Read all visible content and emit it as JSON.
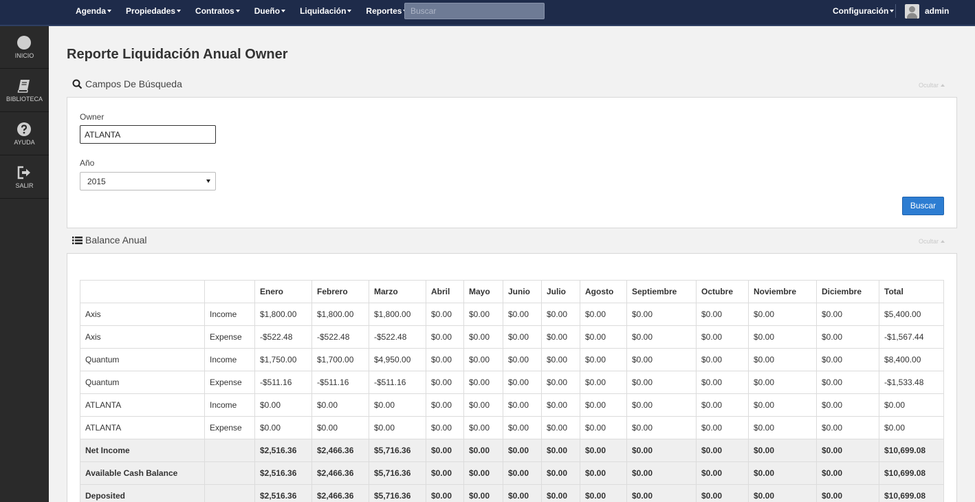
{
  "nav": {
    "items": [
      "Agenda",
      "Propiedades",
      "Contratos",
      "Dueño",
      "Liquidación",
      "Reportes"
    ],
    "search_placeholder": "Buscar",
    "config_label": "Configuración",
    "user_name": "admin"
  },
  "sidebar": {
    "items": [
      {
        "label": "INICIO",
        "icon": "circle-icon"
      },
      {
        "label": "BIBLIOTECA",
        "icon": "book-icon"
      },
      {
        "label": "AYUDA",
        "icon": "help-icon"
      },
      {
        "label": "SALIR",
        "icon": "logout-icon"
      }
    ]
  },
  "page": {
    "title": "Reporte Liquidación Anual Owner"
  },
  "search_section": {
    "title": "Campos De Búsqueda",
    "hide_label": "Ocultar",
    "owner_label": "Owner",
    "owner_value": "ATLANTA",
    "year_label": "Año",
    "year_value": "2015",
    "submit_label": "Buscar"
  },
  "balance_section": {
    "title": "Balance Anual",
    "hide_label": "Ocultar",
    "columns": [
      "",
      "",
      "Enero",
      "Febrero",
      "Marzo",
      "Abril",
      "Mayo",
      "Junio",
      "Julio",
      "Agosto",
      "Septiembre",
      "Octubre",
      "Noviembre",
      "Diciembre",
      "Total"
    ],
    "rows": [
      [
        "Axis",
        "Income",
        "$1,800.00",
        "$1,800.00",
        "$1,800.00",
        "$0.00",
        "$0.00",
        "$0.00",
        "$0.00",
        "$0.00",
        "$0.00",
        "$0.00",
        "$0.00",
        "$0.00",
        "$5,400.00"
      ],
      [
        "Axis",
        "Expense",
        "-$522.48",
        "-$522.48",
        "-$522.48",
        "$0.00",
        "$0.00",
        "$0.00",
        "$0.00",
        "$0.00",
        "$0.00",
        "$0.00",
        "$0.00",
        "$0.00",
        "-$1,567.44"
      ],
      [
        "Quantum",
        "Income",
        "$1,750.00",
        "$1,700.00",
        "$4,950.00",
        "$0.00",
        "$0.00",
        "$0.00",
        "$0.00",
        "$0.00",
        "$0.00",
        "$0.00",
        "$0.00",
        "$0.00",
        "$8,400.00"
      ],
      [
        "Quantum",
        "Expense",
        "-$511.16",
        "-$511.16",
        "-$511.16",
        "$0.00",
        "$0.00",
        "$0.00",
        "$0.00",
        "$0.00",
        "$0.00",
        "$0.00",
        "$0.00",
        "$0.00",
        "-$1,533.48"
      ],
      [
        "ATLANTA",
        "Income",
        "$0.00",
        "$0.00",
        "$0.00",
        "$0.00",
        "$0.00",
        "$0.00",
        "$0.00",
        "$0.00",
        "$0.00",
        "$0.00",
        "$0.00",
        "$0.00",
        "$0.00"
      ],
      [
        "ATLANTA",
        "Expense",
        "$0.00",
        "$0.00",
        "$0.00",
        "$0.00",
        "$0.00",
        "$0.00",
        "$0.00",
        "$0.00",
        "$0.00",
        "$0.00",
        "$0.00",
        "$0.00",
        "$0.00"
      ]
    ],
    "summary_rows": [
      [
        "Net Income",
        "",
        "$2,516.36",
        "$2,466.36",
        "$5,716.36",
        "$0.00",
        "$0.00",
        "$0.00",
        "$0.00",
        "$0.00",
        "$0.00",
        "$0.00",
        "$0.00",
        "$0.00",
        "$10,699.08"
      ],
      [
        "Available Cash Balance",
        "",
        "$2,516.36",
        "$2,466.36",
        "$5,716.36",
        "$0.00",
        "$0.00",
        "$0.00",
        "$0.00",
        "$0.00",
        "$0.00",
        "$0.00",
        "$0.00",
        "$0.00",
        "$10,699.08"
      ],
      [
        "Deposited",
        "",
        "$2,516.36",
        "$2,466.36",
        "$5,716.36",
        "$0.00",
        "$0.00",
        "$0.00",
        "$0.00",
        "$0.00",
        "$0.00",
        "$0.00",
        "$0.00",
        "$0.00",
        "$10,699.08"
      ]
    ]
  }
}
